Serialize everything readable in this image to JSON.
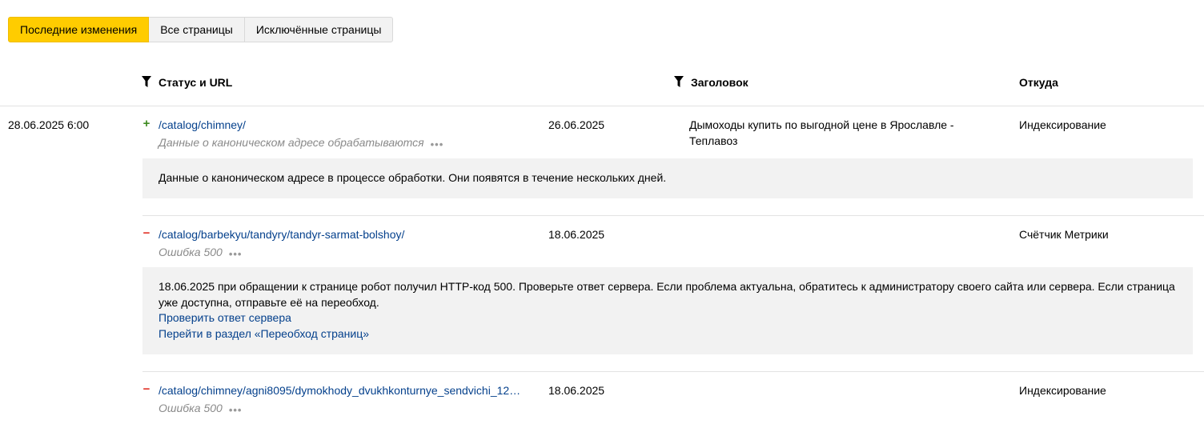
{
  "tabs": [
    {
      "label": "Последние изменения",
      "active": true
    },
    {
      "label": "Все страницы",
      "active": false
    },
    {
      "label": "Исключённые страницы",
      "active": false
    }
  ],
  "columns": {
    "status_url": "Статус и URL",
    "title": "Заголовок",
    "source": "Откуда"
  },
  "group_date": "28.06.2025 6:00",
  "rows": [
    {
      "sign": "+",
      "url": "/catalog/chimney/",
      "status": "Данные о каноническом адресе обрабатываются",
      "date": "26.06.2025",
      "title": "Дымоходы купить по выгодной цене в Ярославле - Теплавоз",
      "source": "Индексирование",
      "info": "Данные о каноническом адресе в процессе обработки. Они появятся в течение нескольких дней."
    },
    {
      "sign": "−",
      "url": "/catalog/barbekyu/tandyry/tandyr-sarmat-bolshoy/",
      "status": "Ошибка 500",
      "date": "18.06.2025",
      "title": "",
      "source": "Счётчик Метрики",
      "info": "18.06.2025 при обращении к странице робот получил HTTP-код 500. Проверьте ответ сервера. Если проблема актуальна, обратитесь к администратору своего сайта или сервера. Если страница уже доступна, отправьте её на переобход.",
      "link1": "Проверить ответ сервера",
      "link2": "Перейти в раздел «Переобход страниц»"
    },
    {
      "sign": "−",
      "url": "/catalog/chimney/agni8095/dymokhody_dvukhkonturnye_sendvichi_12…",
      "status": "Ошибка 500",
      "date": "18.06.2025",
      "title": "",
      "source": "Индексирование"
    }
  ],
  "more_icon": "•••",
  "colors": {
    "accent": "#ffcc00",
    "link": "#04408c",
    "plus": "#3d8a1f",
    "minus": "#e2362a"
  }
}
